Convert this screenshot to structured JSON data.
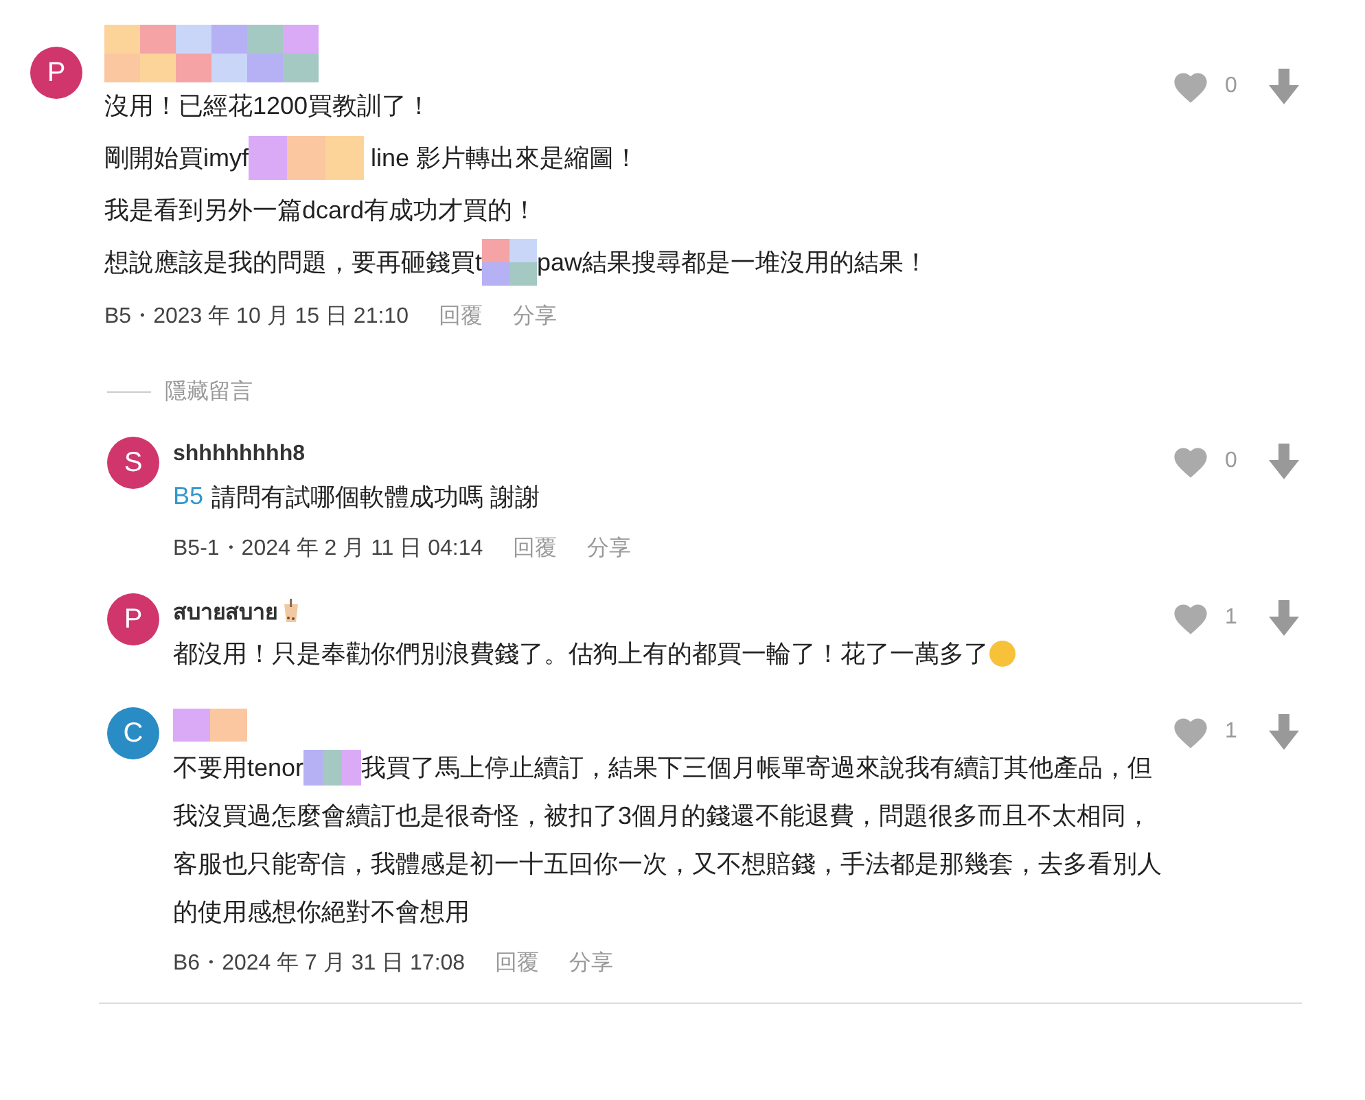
{
  "hide_replies": {
    "label": "隱藏留言"
  },
  "comments": [
    {
      "avatar": "P",
      "color": "#d0366b",
      "author": [
        {
          "kind": "mosaic-grid"
        }
      ],
      "likes": "0",
      "body": [
        [
          {
            "kind": "text",
            "text": "沒用！已經花1200買教訓了！"
          }
        ],
        [
          {
            "kind": "text",
            "text": "剛開始買imyf"
          },
          {
            "kind": "mosaic-strip3"
          },
          {
            "kind": "text",
            "text": " line 影片轉出來是縮圖！"
          }
        ],
        [
          {
            "kind": "text",
            "text": "我是看到另外一篇dcard有成功才買的！"
          }
        ],
        [
          {
            "kind": "text",
            "text": "想說應該是我的問題，要再砸錢買t"
          },
          {
            "kind": "mosaic-square"
          },
          {
            "kind": "text",
            "text": "paw結果搜尋都是一堆沒用的結果！"
          }
        ]
      ],
      "meta": "B5・2023 年 10 月 15 日 21:10",
      "reply": "回覆",
      "share": "分享",
      "children": [
        {
          "avatar": "S",
          "color": "#d0366b",
          "author": [
            {
              "kind": "text",
              "text": "shhhhhhhh8"
            }
          ],
          "likes": "0",
          "mention": "B5",
          "body": [
            [
              {
                "kind": "text",
                "text": "請問有試哪個軟體成功嗎 謝謝"
              }
            ]
          ],
          "meta": "B5-1・2024 年 2 月 11 日 04:14",
          "reply": "回覆",
          "share": "分享"
        },
        {
          "avatar": "P",
          "color": "#d0366b",
          "author": [
            {
              "kind": "text",
              "text": "สบายสบาย"
            },
            {
              "kind": "tea-icon"
            }
          ],
          "likes": "1",
          "body": [
            [
              {
                "kind": "text",
                "text": "都沒用！只是奉勸你們別浪費錢了。估狗上有的都買一輪了！花了一萬多了"
              },
              {
                "kind": "emoji-icon"
              }
            ]
          ]
        },
        {
          "avatar": "C",
          "color": "#2a8cc4",
          "author": [
            {
              "kind": "mosaic-strip2"
            }
          ],
          "likes": "1",
          "body": [
            [
              {
                "kind": "text",
                "text": "不要用tenor"
              },
              {
                "kind": "mosaic-thin"
              },
              {
                "kind": "text",
                "text": "我買了馬上停止續訂，結果下三個月帳單寄過來說我有續訂其他產品，但"
              }
            ],
            [
              {
                "kind": "text",
                "text": "我沒買過怎麼會續訂也是很奇怪，被扣了3個月的錢還不能退費，問題很多而且不太相同，"
              }
            ],
            [
              {
                "kind": "text",
                "text": "客服也只能寄信，我體感是初一十五回你一次，又不想賠錢，手法都是那幾套，去多看別人"
              }
            ],
            [
              {
                "kind": "text",
                "text": "的使用感想你絕對不會想用"
              }
            ]
          ],
          "meta": "B6・2024 年 7 月 31 日 17:08",
          "reply": "回覆",
          "share": "分享"
        }
      ]
    }
  ]
}
